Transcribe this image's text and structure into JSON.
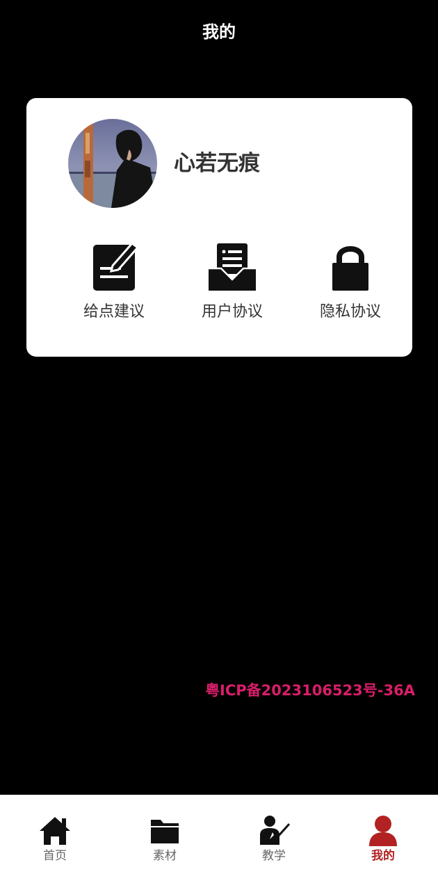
{
  "header": {
    "title": "我的"
  },
  "profile": {
    "avatar_icon": "user-avatar-photo",
    "username": "心若无痕"
  },
  "menu": [
    {
      "label": "给点建议",
      "icon": "edit-note-icon"
    },
    {
      "label": "用户协议",
      "icon": "inbox-document-icon"
    },
    {
      "label": "隐私协议",
      "icon": "lock-icon"
    }
  ],
  "footer": {
    "icp": "粤ICP备2023106523号-36A"
  },
  "tabbar": {
    "items": [
      {
        "label": "首页",
        "icon": "home-icon",
        "active": false
      },
      {
        "label": "素材",
        "icon": "folder-icon",
        "active": false
      },
      {
        "label": "教学",
        "icon": "teacher-icon",
        "active": false
      },
      {
        "label": "我的",
        "icon": "user-icon",
        "active": true
      }
    ]
  },
  "colors": {
    "background": "#000000",
    "card": "#ffffff",
    "accent_active": "#b22222",
    "icp_text": "#d81e6a",
    "tab_inactive": "#666666"
  }
}
